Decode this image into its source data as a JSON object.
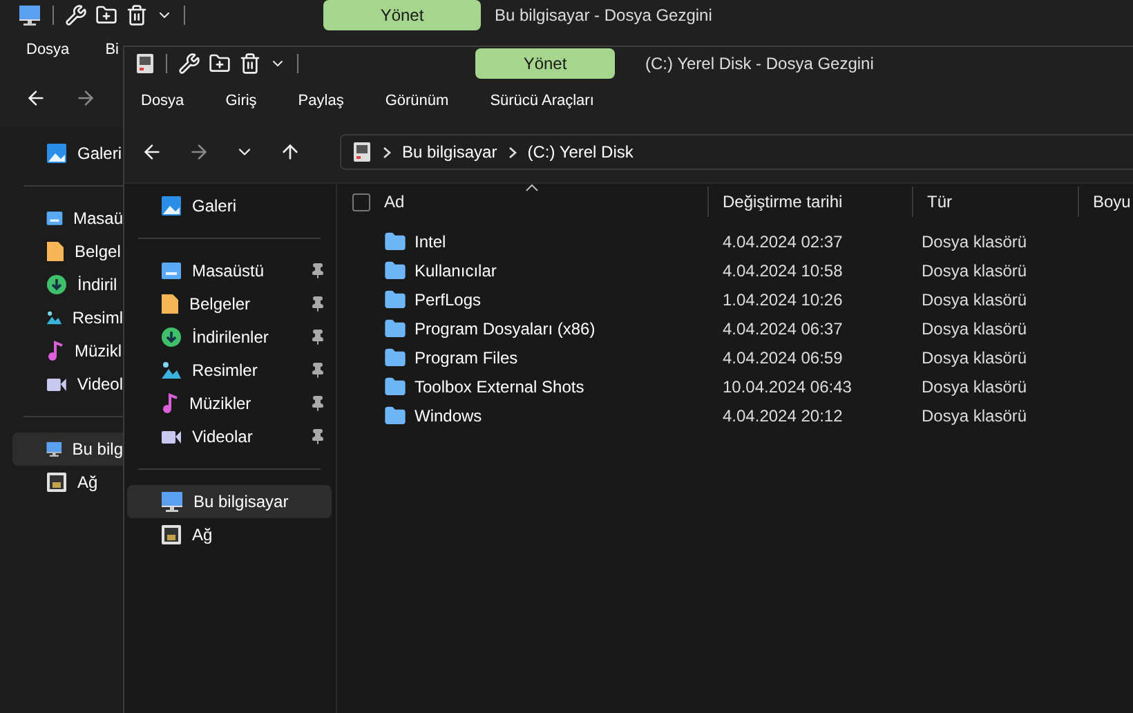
{
  "back_window": {
    "manage_button": "Yönet",
    "title": "Bu bilgisayar - Dosya Gezgini",
    "menu": [
      "Dosya",
      "Bi"
    ],
    "sidebar": [
      {
        "kind": "gallery",
        "label": "Galeri",
        "selected": false
      },
      {
        "kind": "divider"
      },
      {
        "kind": "desktop",
        "label": "Masaü",
        "selected": false
      },
      {
        "kind": "documents",
        "label": "Belgel",
        "selected": false
      },
      {
        "kind": "downloads",
        "label": "İndiril",
        "selected": false
      },
      {
        "kind": "pictures",
        "label": "Resiml",
        "selected": false
      },
      {
        "kind": "music",
        "label": "Müzikl",
        "selected": false
      },
      {
        "kind": "videos",
        "label": "Videol",
        "selected": false
      },
      {
        "kind": "divider"
      },
      {
        "kind": "computer",
        "label": "Bu bilg",
        "selected": true
      },
      {
        "kind": "network",
        "label": "Ağ",
        "selected": false
      }
    ]
  },
  "window": {
    "manage_button": "Yönet",
    "title": "(C:) Yerel Disk - Dosya Gezgini",
    "menu": [
      "Dosya",
      "Giriş",
      "Paylaş",
      "Görünüm",
      "Sürücü Araçları"
    ],
    "breadcrumb": [
      "Bu bilgisayar",
      "(C:) Yerel Disk"
    ],
    "sidebar": [
      {
        "kind": "gallery",
        "label": "Galeri",
        "selected": false,
        "pinned": false
      },
      {
        "kind": "divider"
      },
      {
        "kind": "desktop",
        "label": "Masaüstü",
        "selected": false,
        "pinned": true
      },
      {
        "kind": "documents",
        "label": "Belgeler",
        "selected": false,
        "pinned": true
      },
      {
        "kind": "downloads",
        "label": "İndirilenler",
        "selected": false,
        "pinned": true
      },
      {
        "kind": "pictures",
        "label": "Resimler",
        "selected": false,
        "pinned": true
      },
      {
        "kind": "music",
        "label": "Müzikler",
        "selected": false,
        "pinned": true
      },
      {
        "kind": "videos",
        "label": "Videolar",
        "selected": false,
        "pinned": true
      },
      {
        "kind": "divider"
      },
      {
        "kind": "computer",
        "label": "Bu bilgisayar",
        "selected": true,
        "pinned": false
      },
      {
        "kind": "network",
        "label": "Ağ",
        "selected": false,
        "pinned": false
      }
    ],
    "table": {
      "select_all_checked": false,
      "columns": [
        "Ad",
        "Değiştirme tarihi",
        "Tür",
        "Boyu"
      ],
      "rows": [
        {
          "name": "Intel",
          "modified": "4.04.2024 02:37",
          "type": "Dosya klasörü"
        },
        {
          "name": "Kullanıcılar",
          "modified": "4.04.2024 10:58",
          "type": "Dosya klasörü"
        },
        {
          "name": "PerfLogs",
          "modified": "1.04.2024 10:26",
          "type": "Dosya klasörü"
        },
        {
          "name": "Program Dosyaları (x86)",
          "modified": "4.04.2024 06:37",
          "type": "Dosya klasörü"
        },
        {
          "name": "Program Files",
          "modified": "4.04.2024 06:59",
          "type": "Dosya klasörü"
        },
        {
          "name": "Toolbox External Shots",
          "modified": "10.04.2024 06:43",
          "type": "Dosya klasörü"
        },
        {
          "name": "Windows",
          "modified": "4.04.2024 20:12",
          "type": "Dosya klasörü"
        }
      ]
    }
  }
}
